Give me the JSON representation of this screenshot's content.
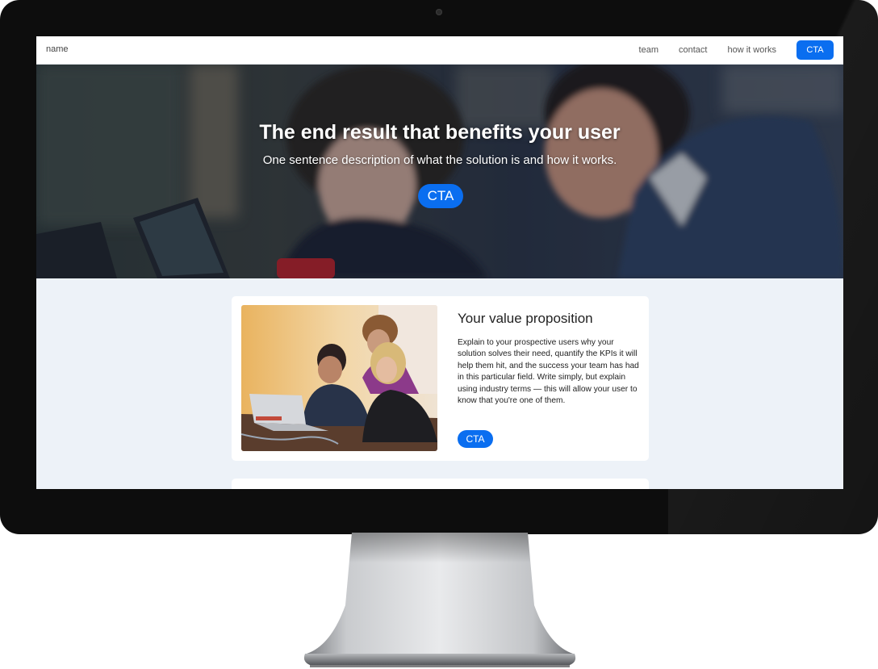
{
  "nav": {
    "brand": "name",
    "links": [
      "team",
      "contact",
      "how it works"
    ],
    "cta": "CTA"
  },
  "hero": {
    "title": "The end result that benefits your user",
    "subtitle": "One sentence description of what the solution is and how it works.",
    "cta": "CTA"
  },
  "value": {
    "title": "Your value proposition",
    "body": "Explain to your prospective users why your solution solves their need, quantify the KPIs it will help them hit, and the success your team has had in this particular field. Write simply, but explain using industry terms — this will allow your user to know that you're one of them.",
    "cta": "CTA"
  },
  "colors": {
    "accent": "#0a6ef0",
    "page_background": "#edf2f8",
    "bezel": "#0d0d0d"
  }
}
